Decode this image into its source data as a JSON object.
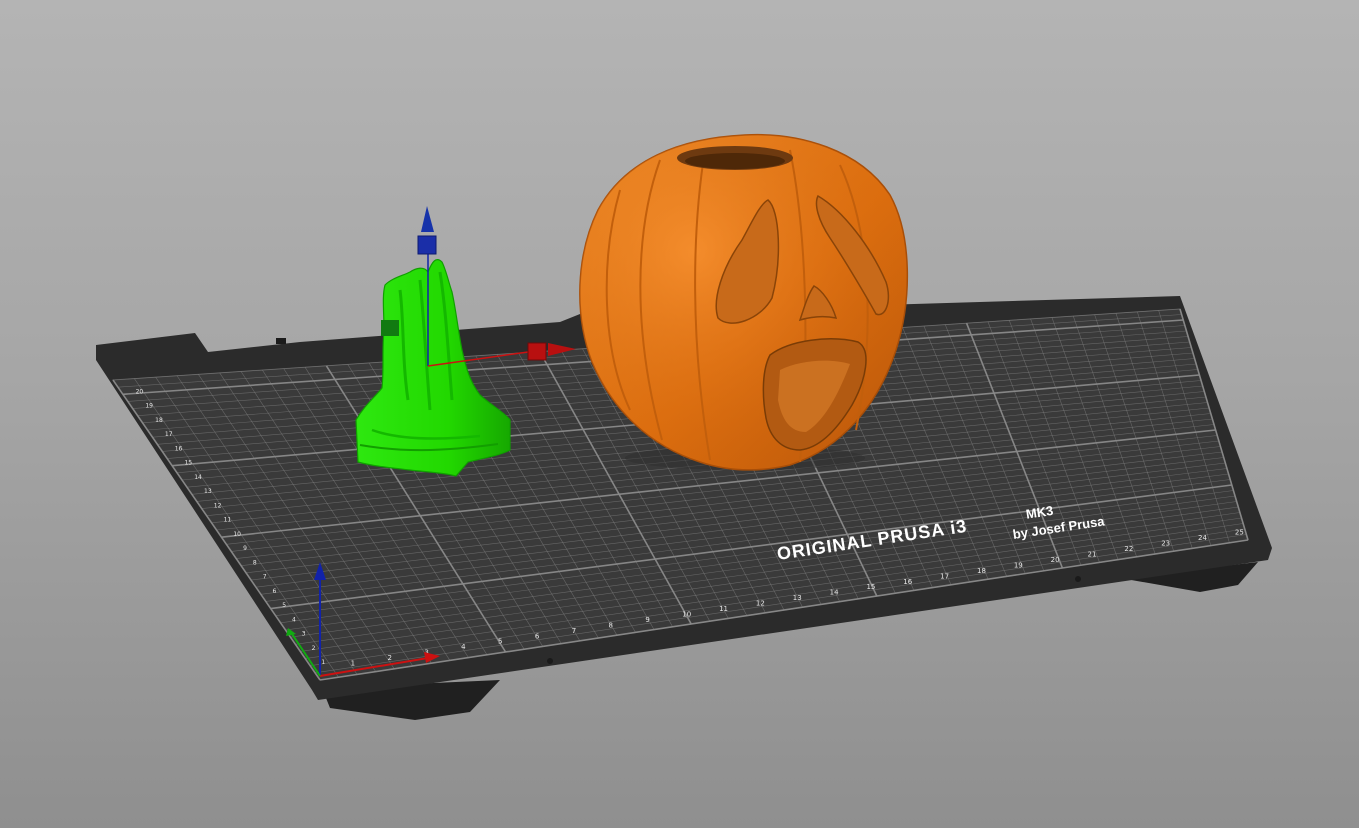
{
  "bed": {
    "brand_line": "ORIGINAL PRUSA i3",
    "model_suffix": "MK3",
    "maker_line": "by Josef Prusa",
    "x_ticks": [
      "1",
      "2",
      "3",
      "4",
      "5",
      "6",
      "7",
      "8",
      "9",
      "10",
      "11",
      "12",
      "13",
      "14",
      "15",
      "16",
      "17",
      "18",
      "19",
      "20",
      "21",
      "22",
      "23",
      "24",
      "25"
    ],
    "y_ticks": [
      "1",
      "2",
      "3",
      "4",
      "5",
      "6",
      "7",
      "8",
      "9",
      "10",
      "11",
      "12",
      "13",
      "14",
      "15",
      "16",
      "17",
      "18",
      "19",
      "20"
    ],
    "surface_color": "#3a3a3a",
    "frame_color": "#2b2b2b",
    "grid_color": "#8a8a8a"
  },
  "objects": [
    {
      "name": "Tree stump model",
      "state": "selected",
      "color": "#22e000"
    },
    {
      "name": "Pumpkin model",
      "state": "unselected",
      "color": "#e87a14"
    }
  ],
  "axes": {
    "x_color": "#cc1111",
    "y_color": "#11aa11",
    "z_color": "#1122aa"
  }
}
